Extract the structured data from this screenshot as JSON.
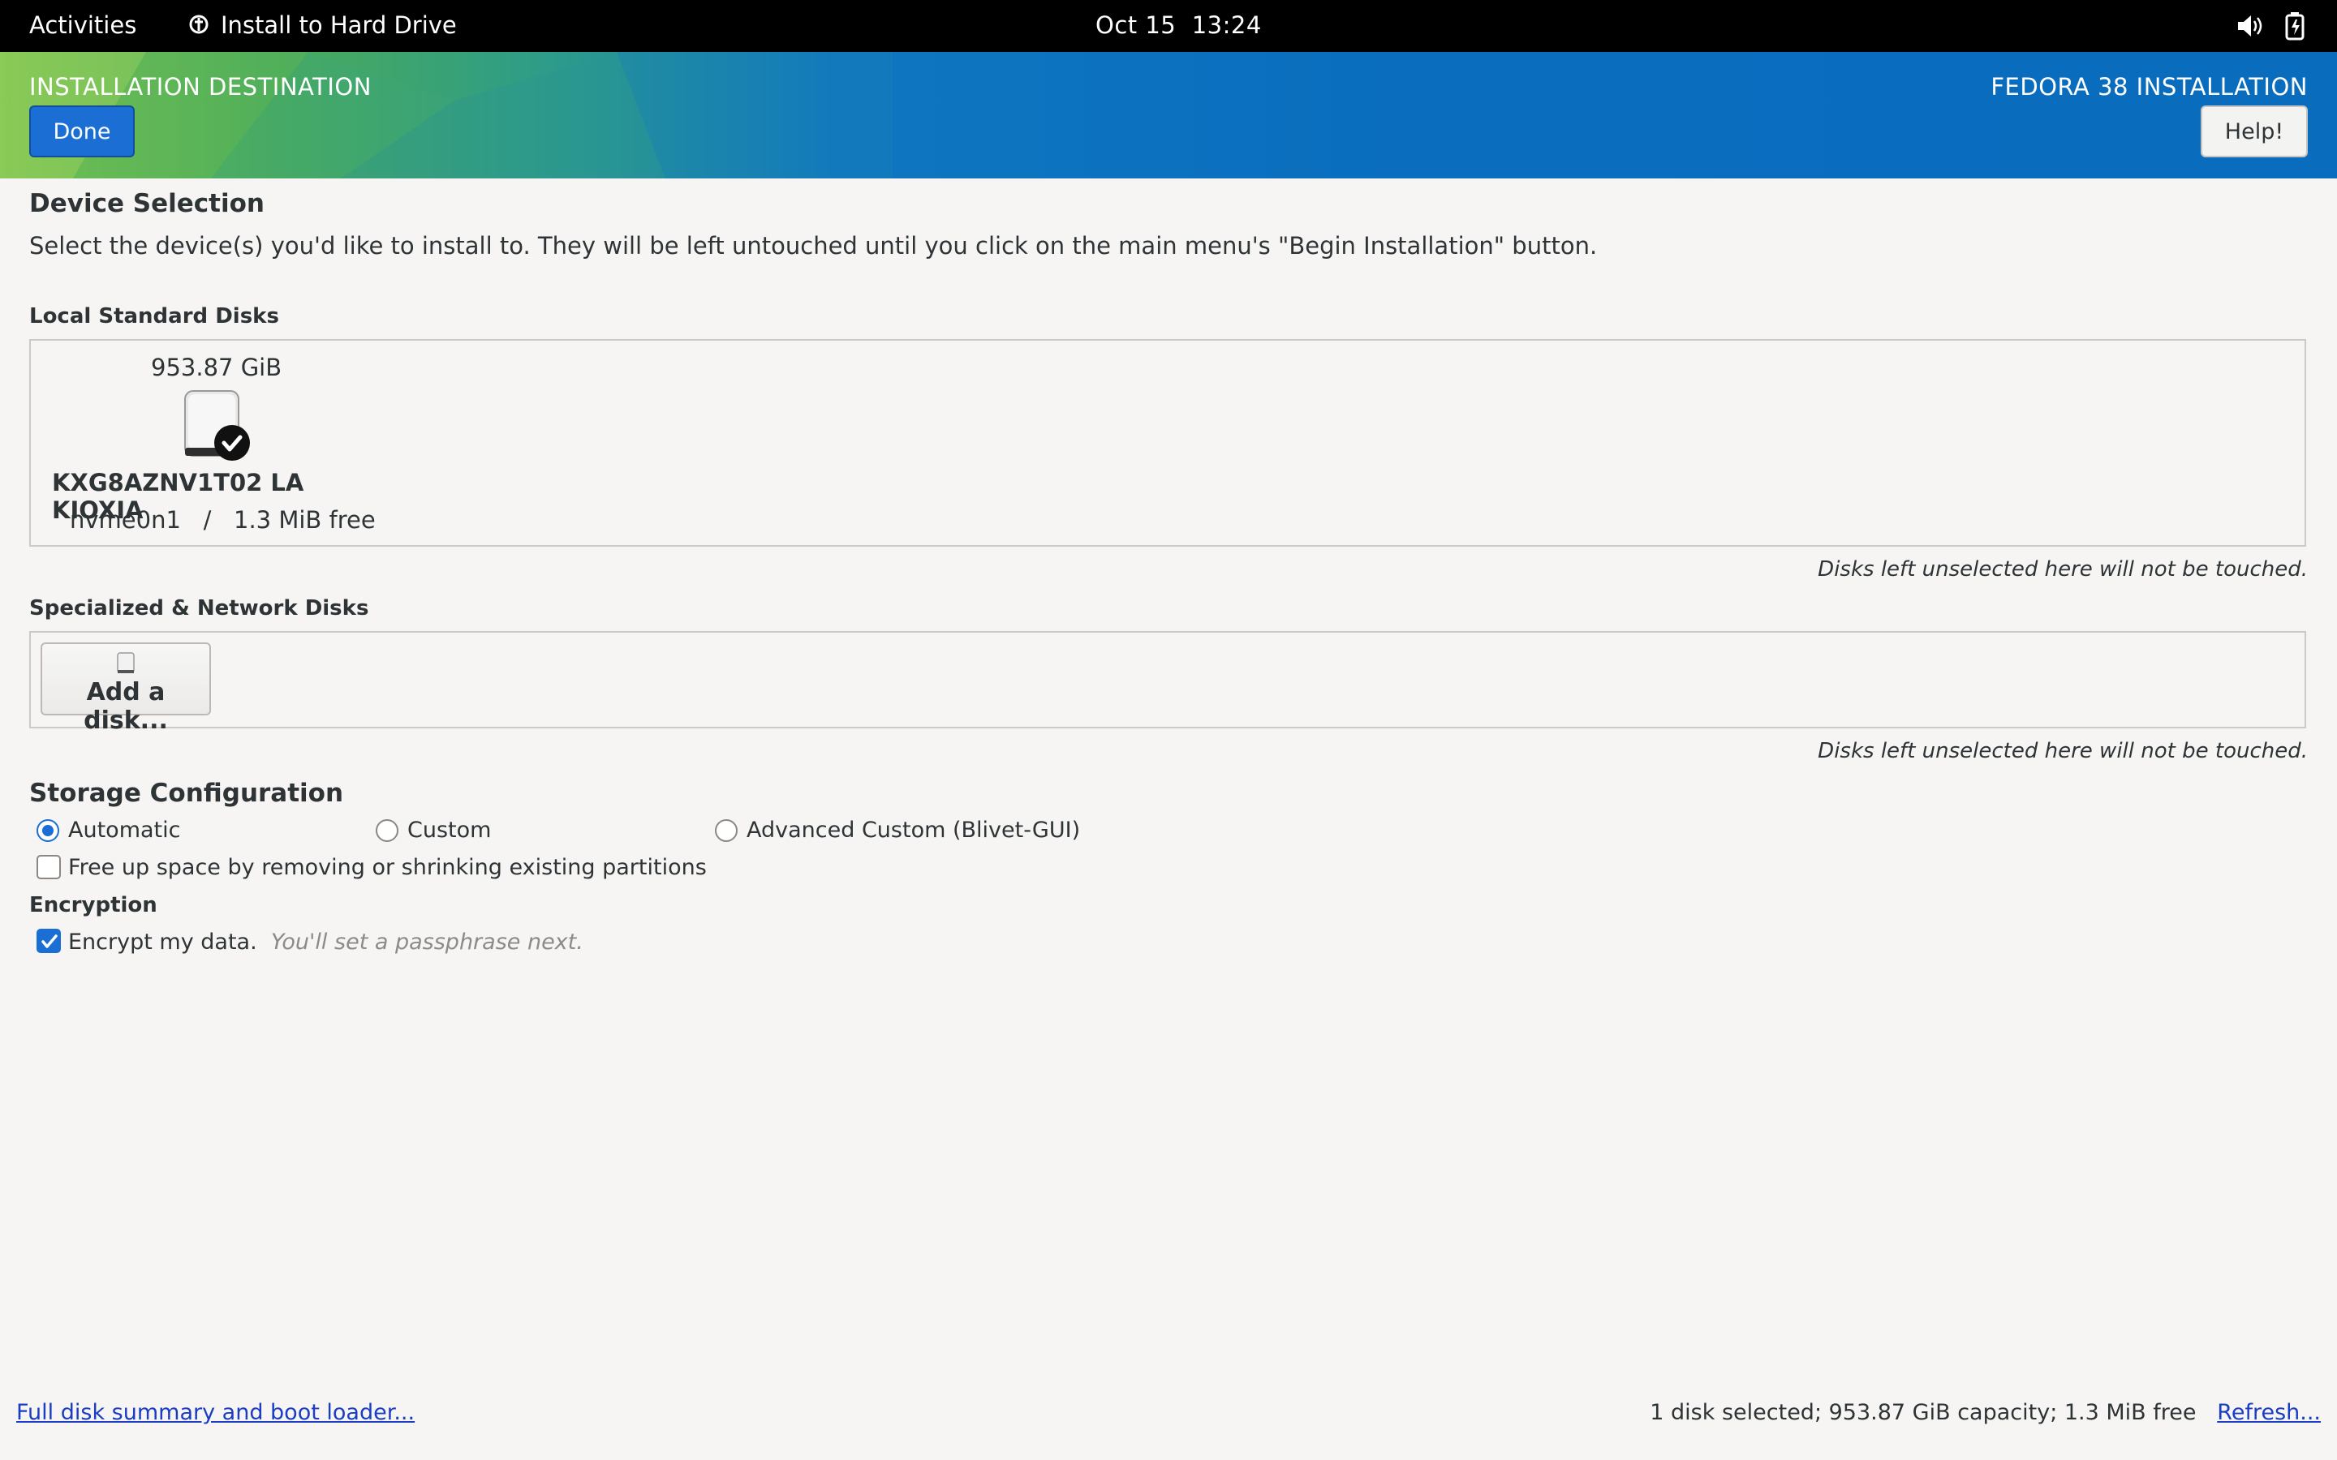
{
  "topbar": {
    "activities": "Activities",
    "app_name": "Install to Hard Drive",
    "date": "Oct 15",
    "time": "13:24",
    "icons": [
      "volume-icon",
      "battery-icon"
    ]
  },
  "header": {
    "title": "INSTALLATION DESTINATION",
    "product": "FEDORA 38 INSTALLATION",
    "done_label": "Done",
    "help_label": "Help!",
    "accent": "#1b6fd4"
  },
  "device_selection": {
    "heading": "Device Selection",
    "description": "Select the device(s) you'd like to install to.  They will be left untouched until you click on the main menu's \"Begin Installation\" button."
  },
  "local_disks": {
    "heading": "Local Standard Disks",
    "disks": [
      {
        "size": "953.87 GiB",
        "name": "KXG8AZNV1T02 LA KIOXIA",
        "info": "nvme0n1   /   1.3 MiB free",
        "selected": true
      }
    ],
    "note": "Disks left unselected here will not be touched."
  },
  "network_disks": {
    "heading": "Specialized & Network Disks",
    "add_label": "Add a disk...",
    "note": "Disks left unselected here will not be touched."
  },
  "storage": {
    "heading": "Storage Configuration",
    "options": [
      {
        "label": "Automatic",
        "selected": true
      },
      {
        "label": "Custom",
        "selected": false
      },
      {
        "label": "Advanced Custom (Blivet-GUI)",
        "selected": false
      }
    ],
    "free_space_label": "Free up space by removing or shrinking existing partitions",
    "free_space_checked": false
  },
  "encryption": {
    "heading": "Encryption",
    "encrypt_label": "Encrypt my data.",
    "encrypt_hint": "You'll set a passphrase next.",
    "encrypt_checked": true
  },
  "footer": {
    "summary_link": "Full disk summary and boot loader...",
    "status": "1 disk selected; 953.87 GiB capacity; 1.3 MiB free",
    "refresh_link": "Refresh..."
  }
}
